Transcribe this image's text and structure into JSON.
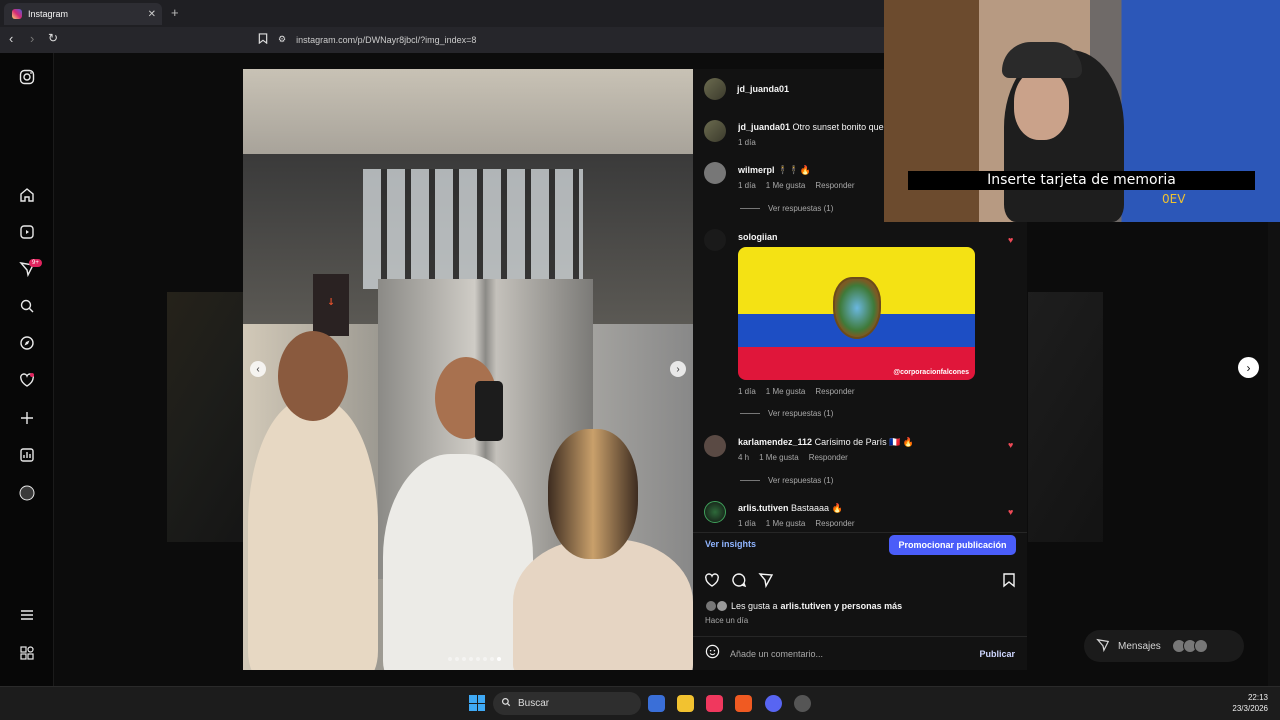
{
  "browser": {
    "tab_title": "Instagram",
    "tab_close": "✕",
    "new_tab": "+",
    "url": "instagram.com/p/DWNayr8jbcl/?img_index=8"
  },
  "post": {
    "author": "jd_juanda01",
    "caption_user": "jd_juanda01",
    "caption_text": "Otro sunset bonito que",
    "caption_time": "1 día",
    "comments": [
      {
        "user": "wilmerpl",
        "text": "🕴🕴🔥",
        "time": "1 día",
        "likes": "1 Me gusta",
        "reply": "Responder",
        "replies": "Ver respuestas (1)"
      },
      {
        "user": "sologiian",
        "text": "",
        "time": "1 día",
        "likes": "1 Me gusta",
        "reply": "Responder",
        "replies": "Ver respuestas (1)",
        "image_credit": "@corporacionfalcones"
      },
      {
        "user": "karlamendez_112",
        "text": "Carísimo de París 🇫🇷 🔥",
        "time": "4 h",
        "likes": "1 Me gusta",
        "reply": "Responder",
        "replies": "Ver respuestas (1)"
      },
      {
        "user": "arlis.tutiven",
        "text": "Bastaaaa 🔥",
        "time": "1 día",
        "likes": "1 Me gusta",
        "reply": "Responder"
      }
    ],
    "insights": "Ver insights",
    "promote": "Promocionar publicación",
    "likes_text_prefix": "Les gusta a",
    "likes_user": "arlis.tutiven",
    "likes_text_suffix": "y personas más",
    "posted_time": "Hace un día",
    "comment_placeholder": "Añade un comentario...",
    "publish": "Publicar"
  },
  "nav": {
    "notifications_badge": "9+"
  },
  "messages": {
    "label": "Mensajes"
  },
  "webcam": {
    "caption": "Inserte tarjeta de memoria",
    "sub": "0EV"
  },
  "taskbar": {
    "search": "Buscar",
    "time": "22:13",
    "date": "23/3/2026"
  },
  "colors": {
    "accent": "#4a5df9",
    "heart": "#ed4956",
    "link": "#8fb4ff"
  }
}
